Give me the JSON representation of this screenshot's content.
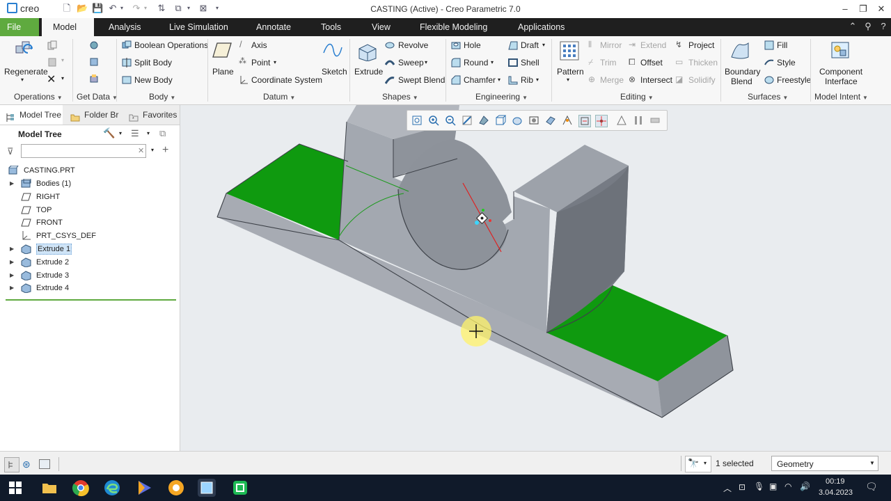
{
  "app": {
    "logo": "creo",
    "title": "CASTING (Active) - Creo Parametric 7.0"
  },
  "ribbon_tabs": [
    "File",
    "Model",
    "Analysis",
    "Live Simulation",
    "Annotate",
    "Tools",
    "View",
    "Flexible Modeling",
    "Applications"
  ],
  "active_tab": "Model",
  "ribbon": {
    "operations": {
      "regenerate": "Regenerate",
      "group": "Operations"
    },
    "get_data": {
      "group": "Get Data"
    },
    "body": {
      "boolean": "Boolean Operations",
      "split": "Split Body",
      "new": "New Body",
      "group": "Body"
    },
    "datum": {
      "plane": "Plane",
      "axis": "Axis",
      "point": "Point",
      "csys": "Coordinate System",
      "sketch": "Sketch",
      "group": "Datum"
    },
    "shapes": {
      "extrude": "Extrude",
      "revolve": "Revolve",
      "sweep": "Sweep",
      "swept_blend": "Swept Blend",
      "group": "Shapes"
    },
    "engineering": {
      "hole": "Hole",
      "round": "Round",
      "chamfer": "Chamfer",
      "draft": "Draft",
      "shell": "Shell",
      "rib": "Rib",
      "group": "Engineering"
    },
    "editing": {
      "pattern": "Pattern",
      "mirror": "Mirror",
      "trim": "Trim",
      "merge": "Merge",
      "extend": "Extend",
      "offset": "Offset",
      "intersect": "Intersect",
      "project": "Project",
      "thicken": "Thicken",
      "solidify": "Solidify",
      "group": "Editing"
    },
    "surfaces": {
      "boundary_blend_1": "Boundary",
      "boundary_blend_2": "Blend",
      "fill": "Fill",
      "style": "Style",
      "freestyle": "Freestyle",
      "group": "Surfaces"
    },
    "model_intent": {
      "component_interface_1": "Component",
      "component_interface_2": "Interface",
      "group": "Model Intent"
    }
  },
  "panel_tabs": [
    "Model Tree",
    "Folder Br",
    "Favorites"
  ],
  "model_tree": {
    "header": "Model Tree",
    "search_value": "",
    "root": "CASTING.PRT",
    "items": [
      {
        "label": "Bodies (1)",
        "icon": "bodies-icon",
        "expandable": true
      },
      {
        "label": "RIGHT",
        "icon": "datum-plane-icon",
        "expandable": false
      },
      {
        "label": "TOP",
        "icon": "datum-plane-icon",
        "expandable": false
      },
      {
        "label": "FRONT",
        "icon": "datum-plane-icon",
        "expandable": false
      },
      {
        "label": "PRT_CSYS_DEF",
        "icon": "csys-icon",
        "expandable": false
      },
      {
        "label": "Extrude 1",
        "icon": "extrude-icon",
        "expandable": true,
        "selected": true
      },
      {
        "label": "Extrude 2",
        "icon": "extrude-icon",
        "expandable": true
      },
      {
        "label": "Extrude 3",
        "icon": "extrude-icon",
        "expandable": true
      },
      {
        "label": "Extrude 4",
        "icon": "extrude-icon",
        "expandable": true
      }
    ]
  },
  "status": {
    "selected": "1 selected",
    "filter": "Geometry"
  },
  "taskbar": {
    "time": "00:19",
    "date": "3.04.2023"
  },
  "colors": {
    "file_tab": "#5faa3f",
    "highlight_green": "#0f9a0f",
    "part_gray": "#a1a6ae"
  }
}
